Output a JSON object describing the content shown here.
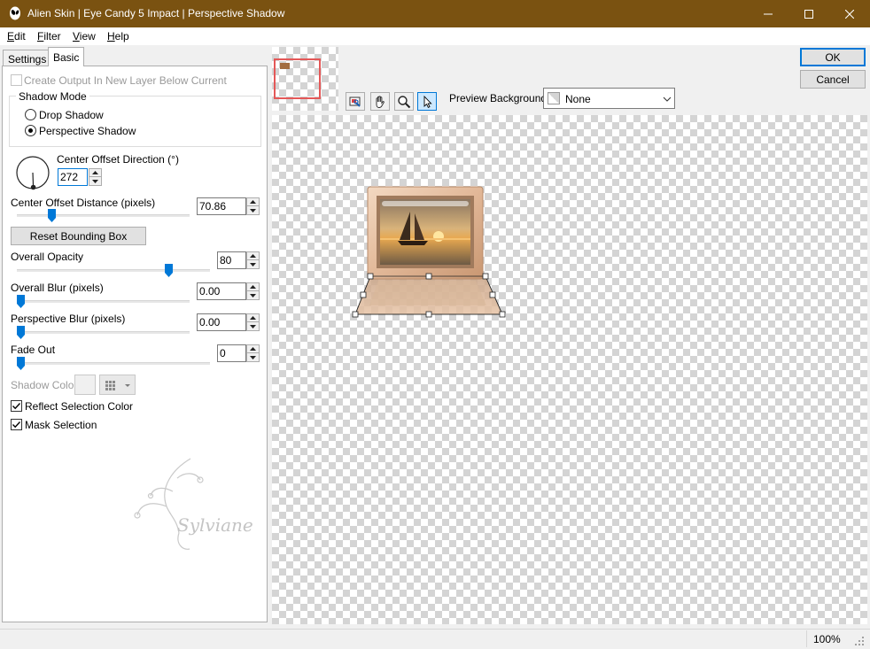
{
  "window": {
    "title": "Alien Skin | Eye Candy 5 Impact | Perspective Shadow",
    "title_color": "#7a5211"
  },
  "menu": {
    "items": [
      {
        "label": "Edit",
        "mnemonic": "E",
        "rest": "dit"
      },
      {
        "label": "Filter",
        "mnemonic": "F",
        "rest": "ilter"
      },
      {
        "label": "View",
        "mnemonic": "V",
        "rest": "iew"
      },
      {
        "label": "Help",
        "mnemonic": "H",
        "rest": "elp"
      }
    ]
  },
  "tabs": [
    {
      "label": "Settings",
      "selected": false
    },
    {
      "label": "Basic",
      "selected": true
    }
  ],
  "basic": {
    "create_output_label": "Create Output In New Layer Below Current",
    "create_output_checked": false,
    "shadow_mode": {
      "title": "Shadow Mode",
      "options": [
        "Drop Shadow",
        "Perspective Shadow"
      ],
      "selected": "Perspective Shadow"
    },
    "center_offset_direction": {
      "label": "Center Offset Direction (°)",
      "value": "272"
    },
    "center_offset_distance": {
      "label": "Center Offset Distance (pixels)",
      "value": "70.86",
      "slider_fraction": 0.2
    },
    "reset_bounding_box_label": "Reset Bounding Box",
    "overall_opacity": {
      "label": "Overall Opacity",
      "value": "80",
      "slider_fraction": 0.8
    },
    "overall_blur": {
      "label": "Overall Blur (pixels)",
      "value": "0.00",
      "slider_fraction": 0.0
    },
    "perspective_blur": {
      "label": "Perspective Blur (pixels)",
      "value": "0.00",
      "slider_fraction": 0.0
    },
    "fade_out": {
      "label": "Fade Out",
      "value": "0",
      "slider_fraction": 0.0
    },
    "shadow_color_label": "Shadow Color",
    "reflect_selection_color": {
      "label": "Reflect Selection Color",
      "checked": true
    },
    "mask_selection": {
      "label": "Mask Selection",
      "checked": true
    },
    "watermark_signature": "Sylviane"
  },
  "actions": {
    "ok_label": "OK",
    "cancel_label": "Cancel"
  },
  "preview": {
    "tools": [
      "preview-toggle-icon",
      "hand-icon",
      "zoom-icon",
      "arrow-icon"
    ],
    "active_tool": "arrow-icon",
    "background_label": "Preview Background:",
    "background_value": "None"
  },
  "status": {
    "zoom": "100%"
  }
}
